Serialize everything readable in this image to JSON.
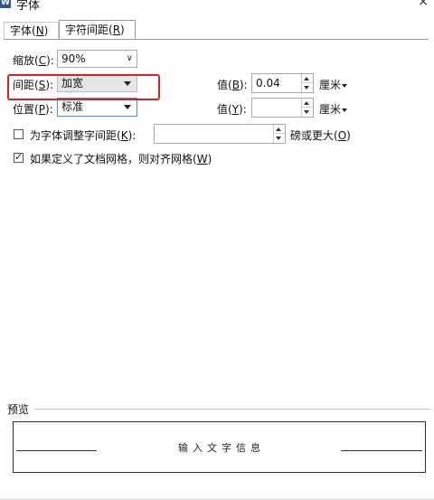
{
  "window": {
    "icon_letter": "W",
    "title": "字体",
    "close": "×"
  },
  "tabs": [
    {
      "label": "字体(",
      "accel": "N",
      "suffix": ")",
      "active": false
    },
    {
      "label": "字符间距(",
      "accel": "R",
      "suffix": ")",
      "active": true
    }
  ],
  "scale": {
    "label_pre": "缩放(",
    "accel": "C",
    "label_post": "):",
    "value": "90%"
  },
  "spacing": {
    "label_pre": "间距(",
    "accel": "S",
    "label_post": "):",
    "value": "加宽"
  },
  "spacing_value": {
    "label_pre": "值(",
    "accel": "B",
    "label_post": "):",
    "value": "0.04",
    "unit": "厘米"
  },
  "position": {
    "label_pre": "位置(",
    "accel": "P",
    "label_post": "):",
    "value": "标准"
  },
  "position_value": {
    "label_pre": "值(",
    "accel": "Y",
    "label_post": "):",
    "value": "",
    "unit": "厘米"
  },
  "kerning": {
    "label_pre": "为字体调整字间距(",
    "accel": "K",
    "label_post": "):",
    "checked": false,
    "value": "",
    "suffix_pre": "磅或更大(",
    "suffix_accel": "O",
    "suffix_post": ")"
  },
  "grid": {
    "label_pre": "如果定义了文档网格，则对齐网格(",
    "accel": "W",
    "label_post": ")",
    "checked": true
  },
  "preview": {
    "label": "预览",
    "sample_text": "输入文字信息"
  },
  "colors": {
    "highlight": "#e02020",
    "focus_border": "#4a90d9"
  }
}
